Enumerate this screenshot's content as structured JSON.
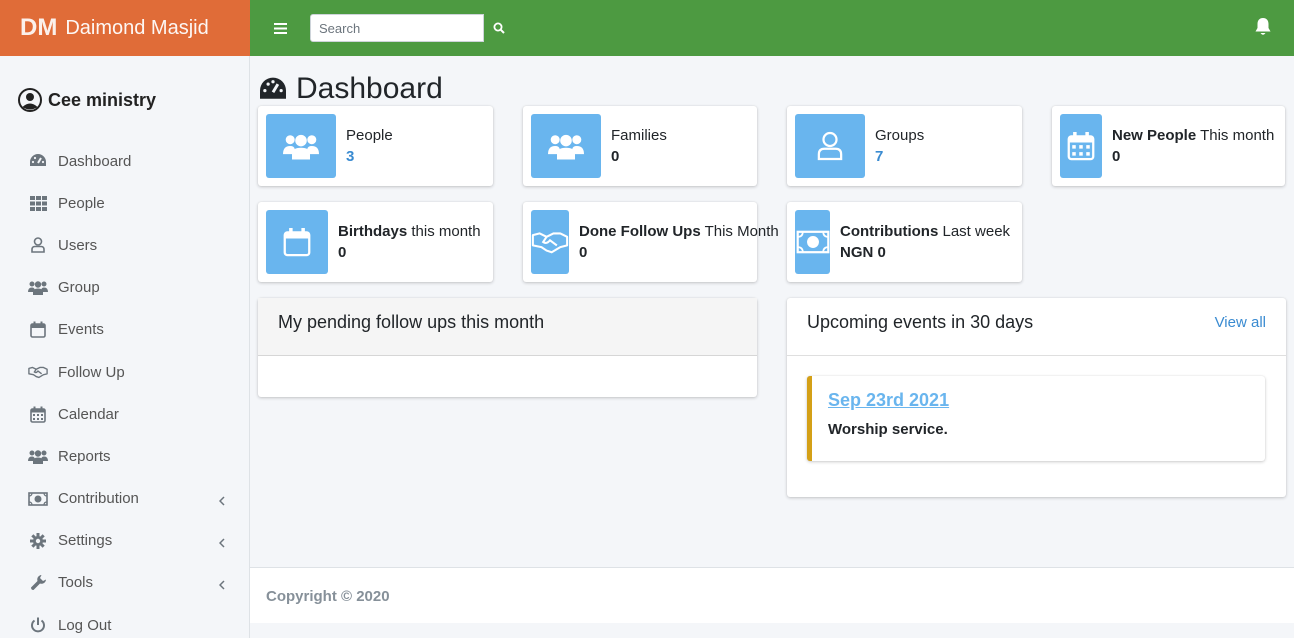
{
  "brand": {
    "abbr": "DM",
    "name": "Daimond Masjid",
    "color": "#e06c38"
  },
  "topnav": {
    "color": "#4d9a41",
    "search_placeholder": "Search"
  },
  "user": {
    "name": "Cee ministry"
  },
  "sidebar": {
    "items": [
      {
        "label": "Dashboard",
        "icon": "tachometer-icon"
      },
      {
        "label": "People",
        "icon": "grid-icon"
      },
      {
        "label": "Users",
        "icon": "user-icon"
      },
      {
        "label": "Group",
        "icon": "users-icon"
      },
      {
        "label": "Events",
        "icon": "calendar-blank-icon"
      },
      {
        "label": "Follow Up",
        "icon": "handshake-icon"
      },
      {
        "label": "Calendar",
        "icon": "calendar-icon"
      },
      {
        "label": "Reports",
        "icon": "users-icon"
      },
      {
        "label": "Contribution",
        "icon": "money-icon",
        "has_submenu": true
      },
      {
        "label": "Settings",
        "icon": "gear-icon",
        "has_submenu": true
      },
      {
        "label": "Tools",
        "icon": "wrench-icon",
        "has_submenu": true
      },
      {
        "label": "Log Out",
        "icon": "power-icon"
      }
    ]
  },
  "page": {
    "title": "Dashboard"
  },
  "stats": {
    "people": {
      "label": "People",
      "value": "3"
    },
    "families": {
      "label": "Families",
      "value": "0"
    },
    "groups": {
      "label": "Groups",
      "value": "7"
    },
    "new_people": {
      "label_bold": "New People",
      "label_rest": " This month",
      "value": "0"
    },
    "birthdays": {
      "label_bold": "Birthdays",
      "label_rest": " this month",
      "value": "0"
    },
    "followups": {
      "label_bold": "Done Follow Ups",
      "label_rest": " This Month",
      "value": "0"
    },
    "contributions": {
      "label_bold": "Contributions",
      "label_rest": " Last week",
      "value": "NGN 0"
    }
  },
  "pending": {
    "title": "My pending follow ups this month"
  },
  "events": {
    "title": "Upcoming events in 30 days",
    "view_all": "View all",
    "items": [
      {
        "date": "Sep 23rd 2021",
        "name": "Worship service."
      }
    ]
  },
  "footer": {
    "copyright": "Copyright © 2020"
  }
}
